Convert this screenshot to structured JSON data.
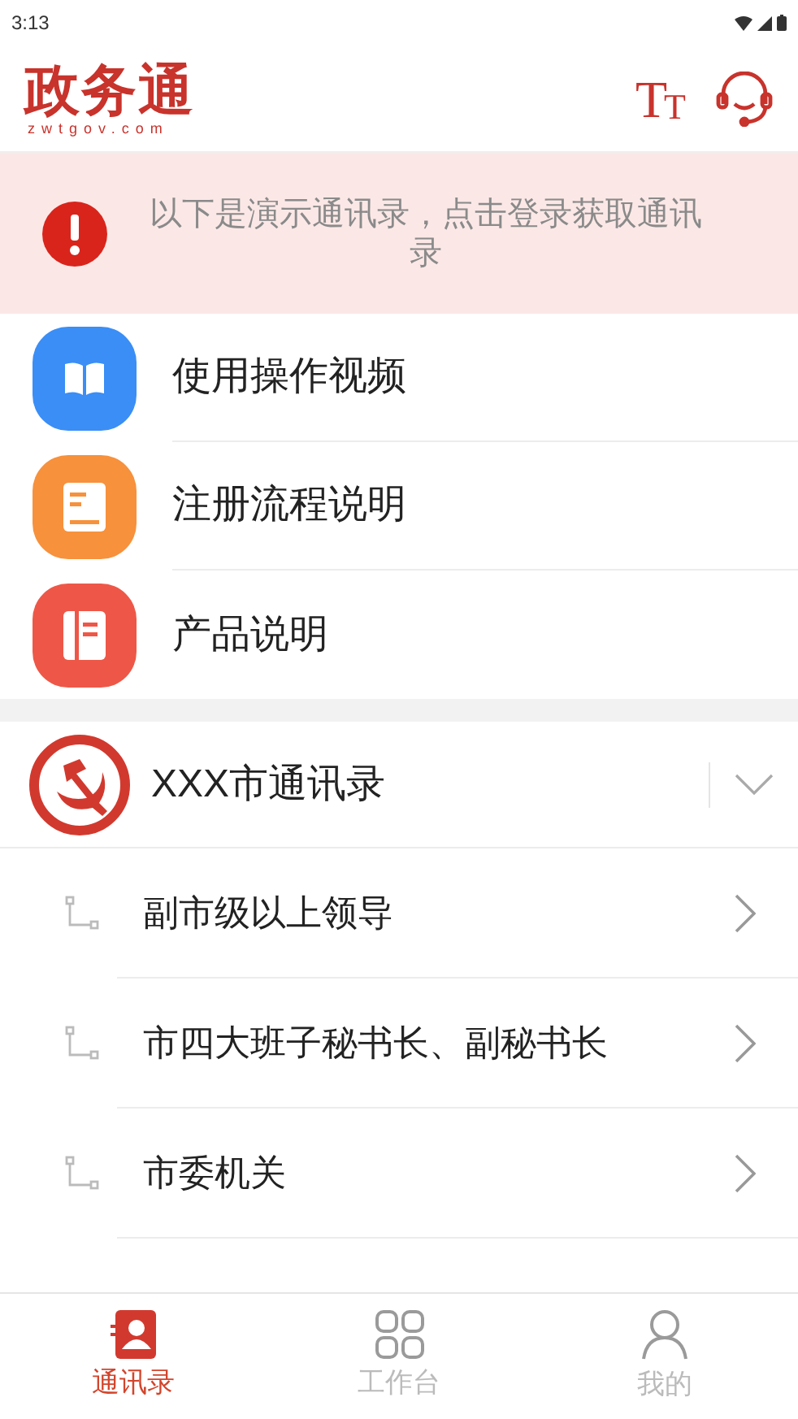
{
  "status_bar": {
    "time": "3:13"
  },
  "header": {
    "logo": "政务通",
    "logo_sub": "zwtgov.com",
    "font_button": {
      "big": "T",
      "small": "T"
    }
  },
  "notice": {
    "text": "以下是演示通讯录，点击登录获取通讯录"
  },
  "menu": [
    {
      "label": "使用操作视频",
      "kind": "video",
      "color": "#3a8ef6"
    },
    {
      "label": "注册流程说明",
      "kind": "register",
      "color": "#f7913c"
    },
    {
      "label": "产品说明",
      "kind": "product",
      "color": "#ee5747"
    }
  ],
  "directory": {
    "title": "XXX市通讯录",
    "expanded": false,
    "items": [
      {
        "label": "副市级以上领导"
      },
      {
        "label": "市四大班子秘书长、副秘书长"
      },
      {
        "label": "市委机关"
      }
    ]
  },
  "tabs": [
    {
      "label": "通讯录",
      "kind": "contacts",
      "selected": true
    },
    {
      "label": "工作台",
      "kind": "workbench",
      "selected": false
    },
    {
      "label": "我的",
      "kind": "profile",
      "selected": false
    }
  ]
}
